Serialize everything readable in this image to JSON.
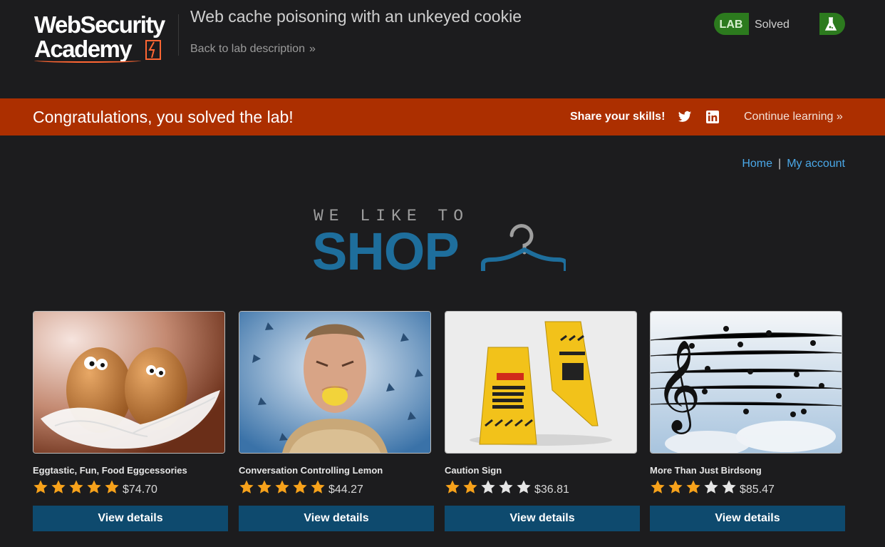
{
  "header": {
    "logo_line1": "WebSecurity",
    "logo_line2": "Academy",
    "lab_title": "Web cache poisoning with an unkeyed cookie",
    "back_link": "Back to lab description",
    "status_label": "LAB",
    "status_value": "Solved",
    "status_color": "#2c7a1e"
  },
  "banner": {
    "message": "Congratulations, you solved the lab!",
    "share_label": "Share your skills!",
    "continue_label": "Continue learning",
    "color": "#ac2f00",
    "icons": [
      "twitter-icon",
      "linkedin-icon"
    ]
  },
  "nav": {
    "home": "Home",
    "separator": "|",
    "account": "My account"
  },
  "shop_logo": {
    "tagline": "WE LIKE TO",
    "word": "SHOP"
  },
  "products": [
    {
      "name": "Egg­tastic, Fun, Food Eggcessories",
      "rating": 5,
      "price": "$74.70",
      "button": "View details",
      "image": "eggs-with-feathers"
    },
    {
      "name": "Conversation Controlling Lemon",
      "rating": 5,
      "price": "$44.27",
      "button": "View details",
      "image": "man-biting-lemon"
    },
    {
      "name": "Caution Sign",
      "rating": 2,
      "price": "$36.81",
      "button": "View details",
      "image": "yellow-caution-signs"
    },
    {
      "name": "More Than Just Birdsong",
      "rating": 3,
      "price": "$85.47",
      "button": "View details",
      "image": "birds-on-music-staff"
    }
  ]
}
